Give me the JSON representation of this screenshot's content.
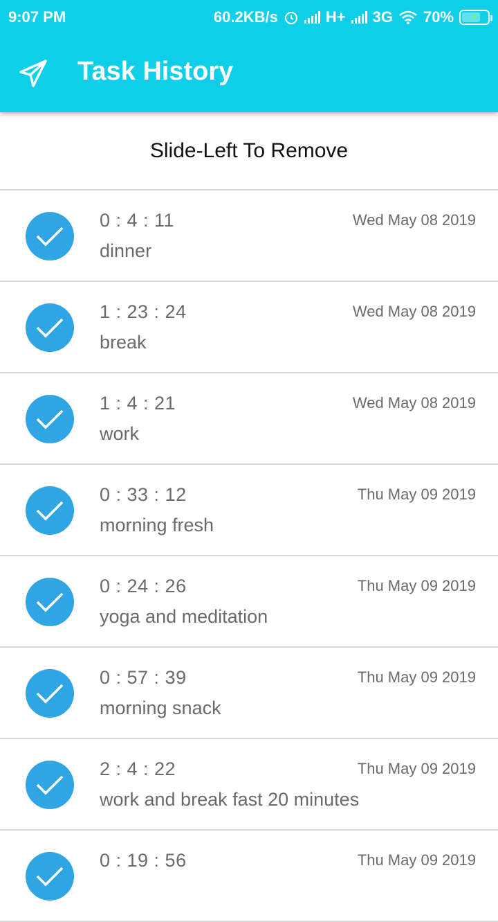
{
  "status_bar": {
    "time": "9:07 PM",
    "speed": "60.2KB/s",
    "network_1": "H+",
    "network_2": "3G",
    "battery": "70%"
  },
  "toolbar": {
    "title": "Task History",
    "icon": "paper-plane-icon"
  },
  "hint": "Slide-Left To Remove",
  "tasks": [
    {
      "duration": "0 : 4 : 11",
      "name": "dinner",
      "date": "Wed May 08 2019"
    },
    {
      "duration": "1 : 23 : 24",
      "name": "break",
      "date": "Wed May 08 2019"
    },
    {
      "duration": "1 : 4 : 21",
      "name": "work",
      "date": "Wed May 08 2019"
    },
    {
      "duration": "0 : 33 : 12",
      "name": "morning fresh",
      "date": "Thu May 09 2019"
    },
    {
      "duration": "0 : 24 : 26",
      "name": "yoga and meditation",
      "date": "Thu May 09 2019"
    },
    {
      "duration": "0 : 57 : 39",
      "name": "morning snack",
      "date": "Thu May 09 2019"
    },
    {
      "duration": "2 : 4 : 22",
      "name": "work and break fast 20 minutes",
      "date": "Thu May 09 2019"
    },
    {
      "duration": "0 : 19 : 56",
      "name": "",
      "date": "Thu May 09 2019"
    }
  ],
  "colors": {
    "appbar": "#0dcfe8",
    "check": "#2fa6e3",
    "text_secondary": "#6a6a6a"
  }
}
